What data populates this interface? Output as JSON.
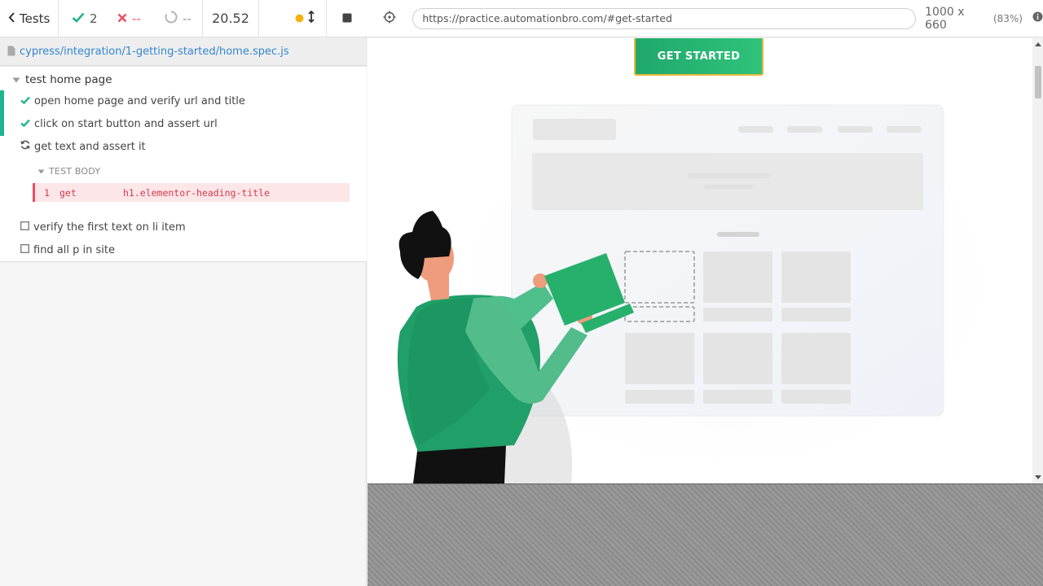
{
  "reporter": {
    "tests_label": "Tests",
    "passed": "2",
    "failed": "--",
    "pending": "--",
    "duration": "20.52",
    "spec_path": "cypress/integration/1-getting-started/home.spec.js",
    "suite_title": "test home page",
    "tests": [
      {
        "title": "open home page and verify url and title",
        "state": "passed"
      },
      {
        "title": "click on start button and assert url",
        "state": "passed"
      },
      {
        "title": "get text and assert it",
        "state": "running"
      },
      {
        "title": "verify the first text on li item",
        "state": "pending"
      },
      {
        "title": "find all p in site",
        "state": "pending"
      }
    ],
    "hook_title": "TEST BODY",
    "command": {
      "number": "1",
      "name": "get",
      "message": "h1.elementor-heading-title"
    }
  },
  "aut": {
    "url": "https://practice.automationbro.com/#get-started",
    "viewport": "1000 x 660",
    "scale": "(83%)",
    "button_label": "GET STARTED"
  },
  "colors": {
    "passed": "#1fb58f",
    "failed": "#e94f5f",
    "link": "#3386d1",
    "accent_green": "#2fc37b",
    "running_dot": "#f5b30e"
  },
  "icons": [
    "chevron-left-icon",
    "check-icon",
    "x-icon",
    "circle-notch-icon",
    "arrows-v-icon",
    "stop-icon",
    "file-icon",
    "caret-down-icon",
    "sync-icon",
    "square-icon",
    "crosshairs-icon",
    "info-icon"
  ]
}
